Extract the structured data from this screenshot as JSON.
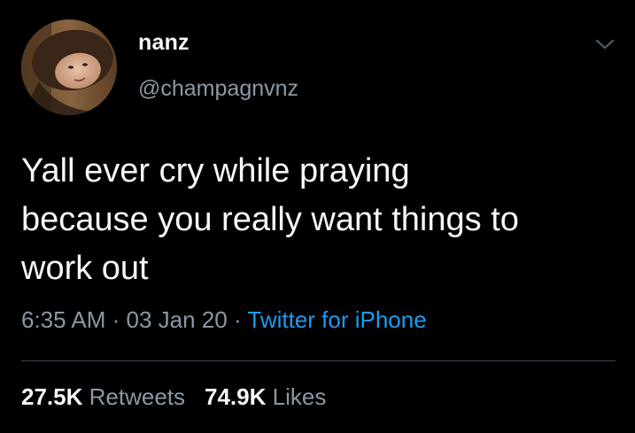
{
  "tweet": {
    "author": {
      "display_name": "nanz",
      "handle": "@champagnvnz"
    },
    "text": "Yall ever cry while praying\nbecause you really want things to\nwork out",
    "time": "6:35 AM",
    "separator": " · ",
    "date": "03 Jan 20",
    "source": "Twitter for iPhone",
    "retweets": {
      "count": "27.5K",
      "label": "Retweets"
    },
    "likes": {
      "count": "74.9K",
      "label": "Likes"
    }
  },
  "icons": {
    "avatar": "avatar",
    "more": "chevron-down-icon"
  },
  "colors": {
    "background": "#000000",
    "text": "#f5f8fa",
    "secondary": "#8b98a5",
    "link": "#1d9bf0",
    "divider": "#38444d"
  }
}
